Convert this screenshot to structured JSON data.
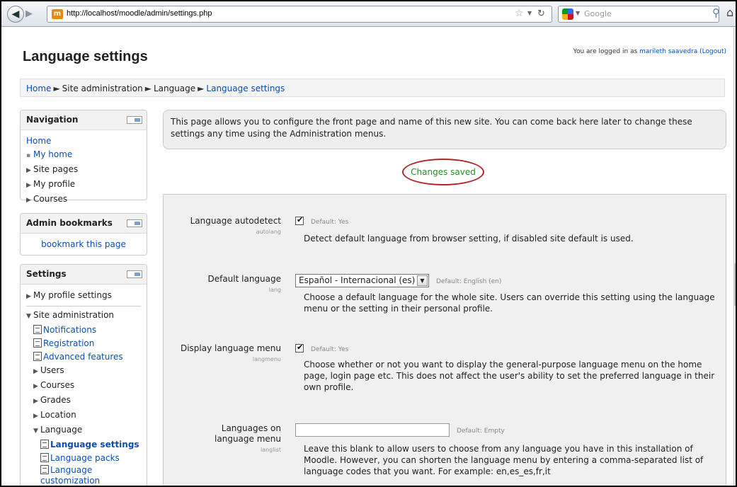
{
  "browser": {
    "url": "http://localhost/moodle/admin/settings.php",
    "search_placeholder": "Google",
    "favicon_text": "m"
  },
  "page": {
    "title": "Language settings",
    "login_prefix": "You are logged in as",
    "user_name": "marileth saavedra",
    "logout": "(Logout)"
  },
  "breadcrumb": [
    "Home",
    "Site administration",
    "Language",
    "Language settings"
  ],
  "navigation": {
    "title": "Navigation",
    "home": "Home",
    "items": [
      "My home",
      "Site pages",
      "My profile",
      "Courses"
    ]
  },
  "bookmarks": {
    "title": "Admin bookmarks",
    "link": "bookmark this page"
  },
  "settings_block": {
    "title": "Settings",
    "my_profile": "My profile settings",
    "site_admin": "Site administration",
    "admin_items": [
      "Notifications",
      "Registration",
      "Advanced features"
    ],
    "admin_folders": [
      "Users",
      "Courses",
      "Grades",
      "Location",
      "Language"
    ],
    "language_items": [
      "Language settings",
      "Language packs",
      "Language customization"
    ]
  },
  "intro": "This page allows you to configure the front page and name of this new site. You can come back here later to change these settings any time using the Administration menus.",
  "status": "Changes saved",
  "settings": [
    {
      "label": "Language autodetect",
      "key": "autolang",
      "default": "Default: Yes",
      "desc": "Detect default language from browser setting, if disabled site default is used."
    },
    {
      "label": "Default language",
      "key": "lang",
      "value": "Español - Internacional (es)",
      "default": "Default: English (en)",
      "desc": "Choose a default language for the whole site. Users can override this setting using the language menu or the setting in their personal profile."
    },
    {
      "label": "Display language menu",
      "key": "langmenu",
      "default": "Default: Yes",
      "desc": "Choose whether or not you want to display the general-purpose language menu on the home page, login page etc. This does not affect the user's ability to set the preferred language in their own profile."
    },
    {
      "label": "Languages on language menu",
      "key": "langlist",
      "default": "Default: Empty",
      "desc": "Leave this blank to allow users to choose from any language you have in this installation of Moodle. However, you can shorten the language menu by entering a comma-separated list of language codes that you want. For example: en,es_es,fr,it"
    }
  ]
}
